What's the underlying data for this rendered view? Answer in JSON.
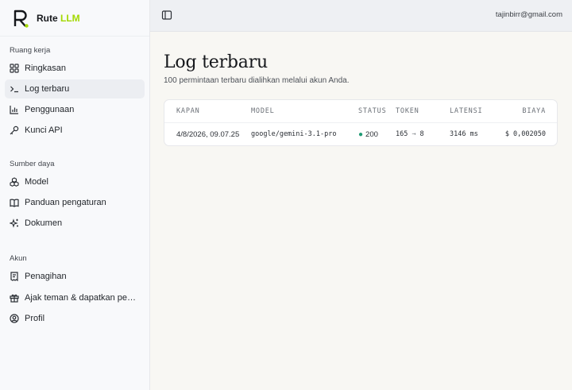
{
  "app": {
    "name_primary": "Rute",
    "name_accent": "LLM",
    "accent_color": "#a3d900"
  },
  "topbar": {
    "user_email": "tajinbirr@gmail.com",
    "toggle_icon": "sidebar-toggle-icon"
  },
  "sidebar": {
    "sections": [
      {
        "label": "Ruang kerja",
        "items": [
          {
            "label": "Ringkasan",
            "icon": "dashboard-icon"
          },
          {
            "label": "Log terbaru",
            "icon": "terminal-icon",
            "active": true
          },
          {
            "label": "Penggunaan",
            "icon": "bar-chart-icon"
          },
          {
            "label": "Kunci API",
            "icon": "key-icon"
          }
        ]
      },
      {
        "label": "Sumber daya",
        "items": [
          {
            "label": "Model",
            "icon": "boxes-icon"
          },
          {
            "label": "Panduan pengaturan",
            "icon": "book-icon"
          },
          {
            "label": "Dokumen",
            "icon": "sparkles-icon"
          }
        ]
      },
      {
        "label": "Akun",
        "items": [
          {
            "label": "Penagihan",
            "icon": "receipt-icon"
          },
          {
            "label": "Ajak teman & dapatkan pen…",
            "icon": "gift-icon"
          },
          {
            "label": "Profil",
            "icon": "user-circle-icon"
          }
        ]
      }
    ]
  },
  "main": {
    "title": "Log terbaru",
    "subtitle": "100 permintaan terbaru dialihkan melalui akun Anda.",
    "table": {
      "headers": {
        "when": "KAPAN",
        "model": "MODEL",
        "status": "STATUS",
        "tokens": "TOKEN",
        "latency": "LATENSI",
        "cost": "BIAYA"
      },
      "rows": [
        {
          "when": "4/8/2026, 09.07.25",
          "model": "google/gemini-3.1-pro",
          "status": "200",
          "tokens_in": "165",
          "tokens_arrow": "→",
          "tokens_out": "8",
          "latency": "3146 ms",
          "cost": "$ 0,002050"
        }
      ]
    }
  }
}
